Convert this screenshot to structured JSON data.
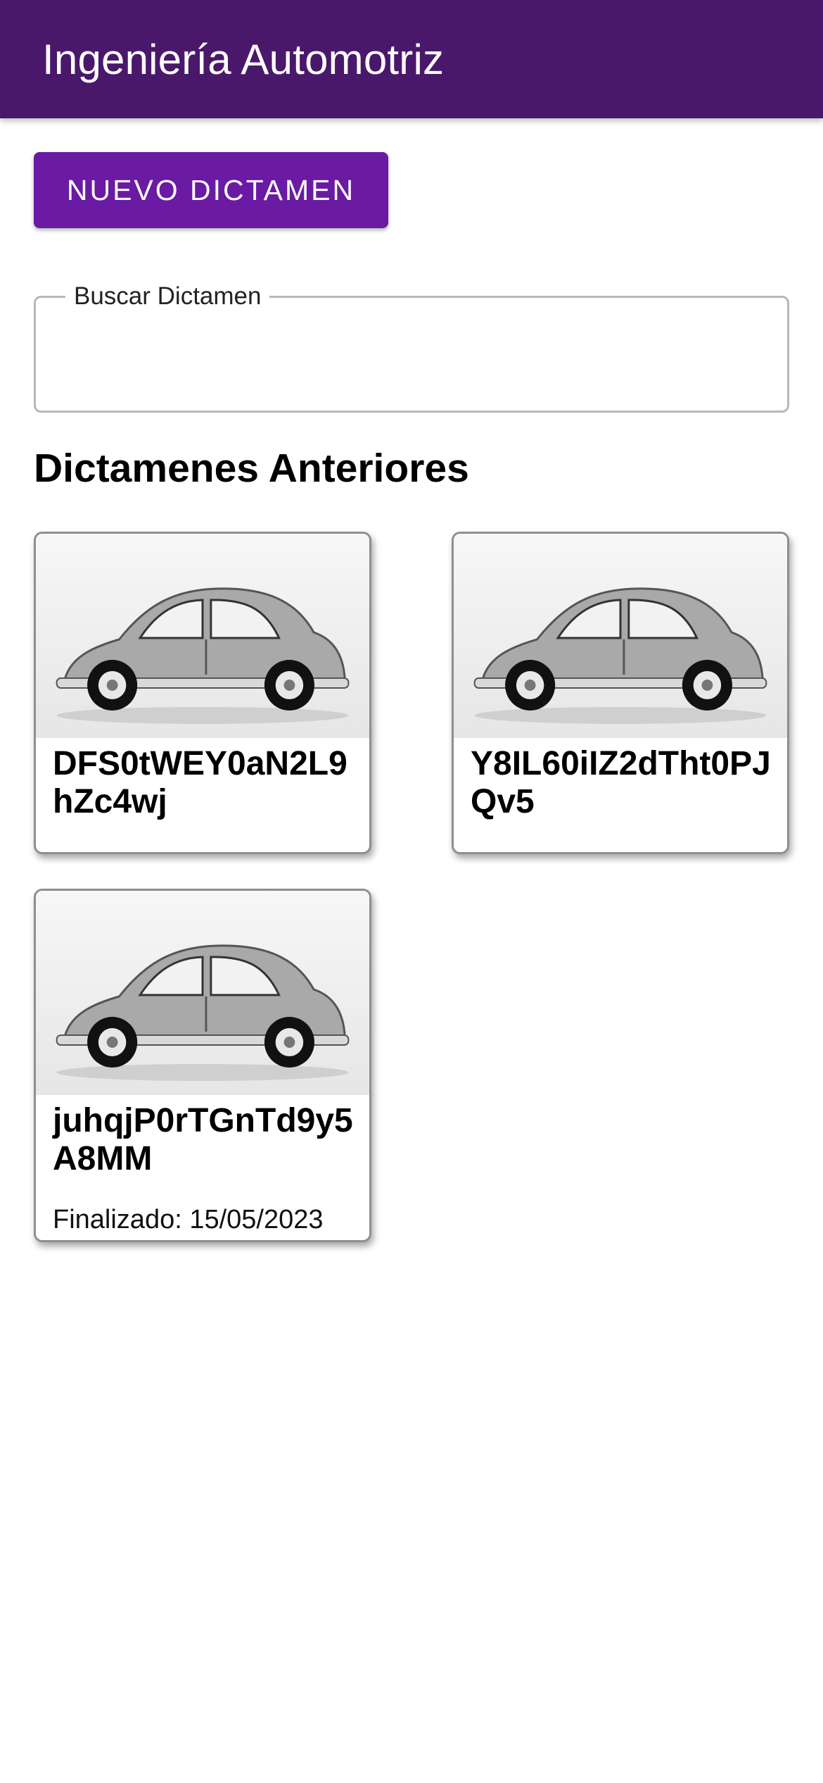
{
  "app": {
    "title": "Ingeniería Automotriz"
  },
  "actions": {
    "new_label": "NUEVO DICTAMEN"
  },
  "search": {
    "label": "Buscar Dictamen",
    "value": ""
  },
  "section": {
    "title": "Dictamenes Anteriores"
  },
  "cards": [
    {
      "id": "DFS0tWEY0aN2L9hZc4wj",
      "image": "vintage-beetle-car-photo"
    },
    {
      "id": "Y8IL60iIZ2dTht0PJQv5",
      "image": "vintage-beetle-car-photo"
    },
    {
      "id": "juhqjP0rTGnTd9y5A8MM",
      "image": "vintage-beetle-car-photo",
      "status": "Finalizado: 15/05/2023"
    }
  ],
  "colors": {
    "appbar": "#4a186b",
    "primary_button": "#6a1aa3"
  }
}
